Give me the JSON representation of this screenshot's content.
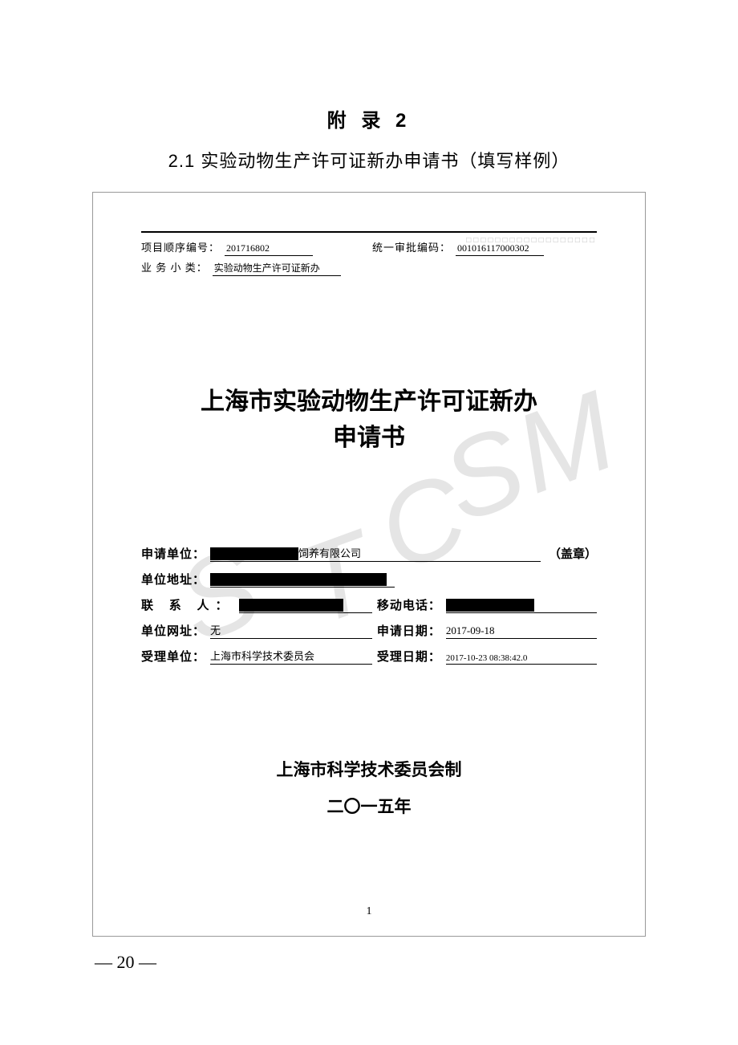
{
  "appendix_title": "附 录 2",
  "section_title": "2.1 实验动物生产许可证新办申请书（填写样例）",
  "dotted_placeholder": "□□□□□□□□□□□□□□□□□□",
  "meta": {
    "project_no_label": "项目顺序编号：",
    "project_no_value": "201716802",
    "approval_code_label": "统一审批编码：",
    "approval_code_value": "001016117000302",
    "biz_subtype_label": "业 务 小 类：",
    "biz_subtype_value": "实验动物生产许可证新办"
  },
  "main_title_line1": "上海市实验动物生产许可证新办",
  "main_title_line2": "申请书",
  "fields": {
    "applicant_label": "申请单位：",
    "applicant_suffix": "饲养有限公司",
    "stamp_note": "（盖章）",
    "address_label": "单位地址：",
    "contact_label": "联 系 人：",
    "mobile_label": "移动电话：",
    "website_label": "单位网址：",
    "website_value": "无",
    "apply_date_label": "申请日期：",
    "apply_date_value": "2017-09-18",
    "accept_unit_label": "受理单位：",
    "accept_unit_value": "上海市科学技术委员会",
    "accept_date_label": "受理日期：",
    "accept_date_value": "2017-10-23 08:38:42.0"
  },
  "issuer_line1": "上海市科学技术委员会制",
  "issuer_line2": "二〇一五年",
  "inner_page_number": "1",
  "outer_page_number": "— 20 —",
  "watermark_chars": [
    "S",
    "T",
    "C",
    "S",
    "M"
  ]
}
